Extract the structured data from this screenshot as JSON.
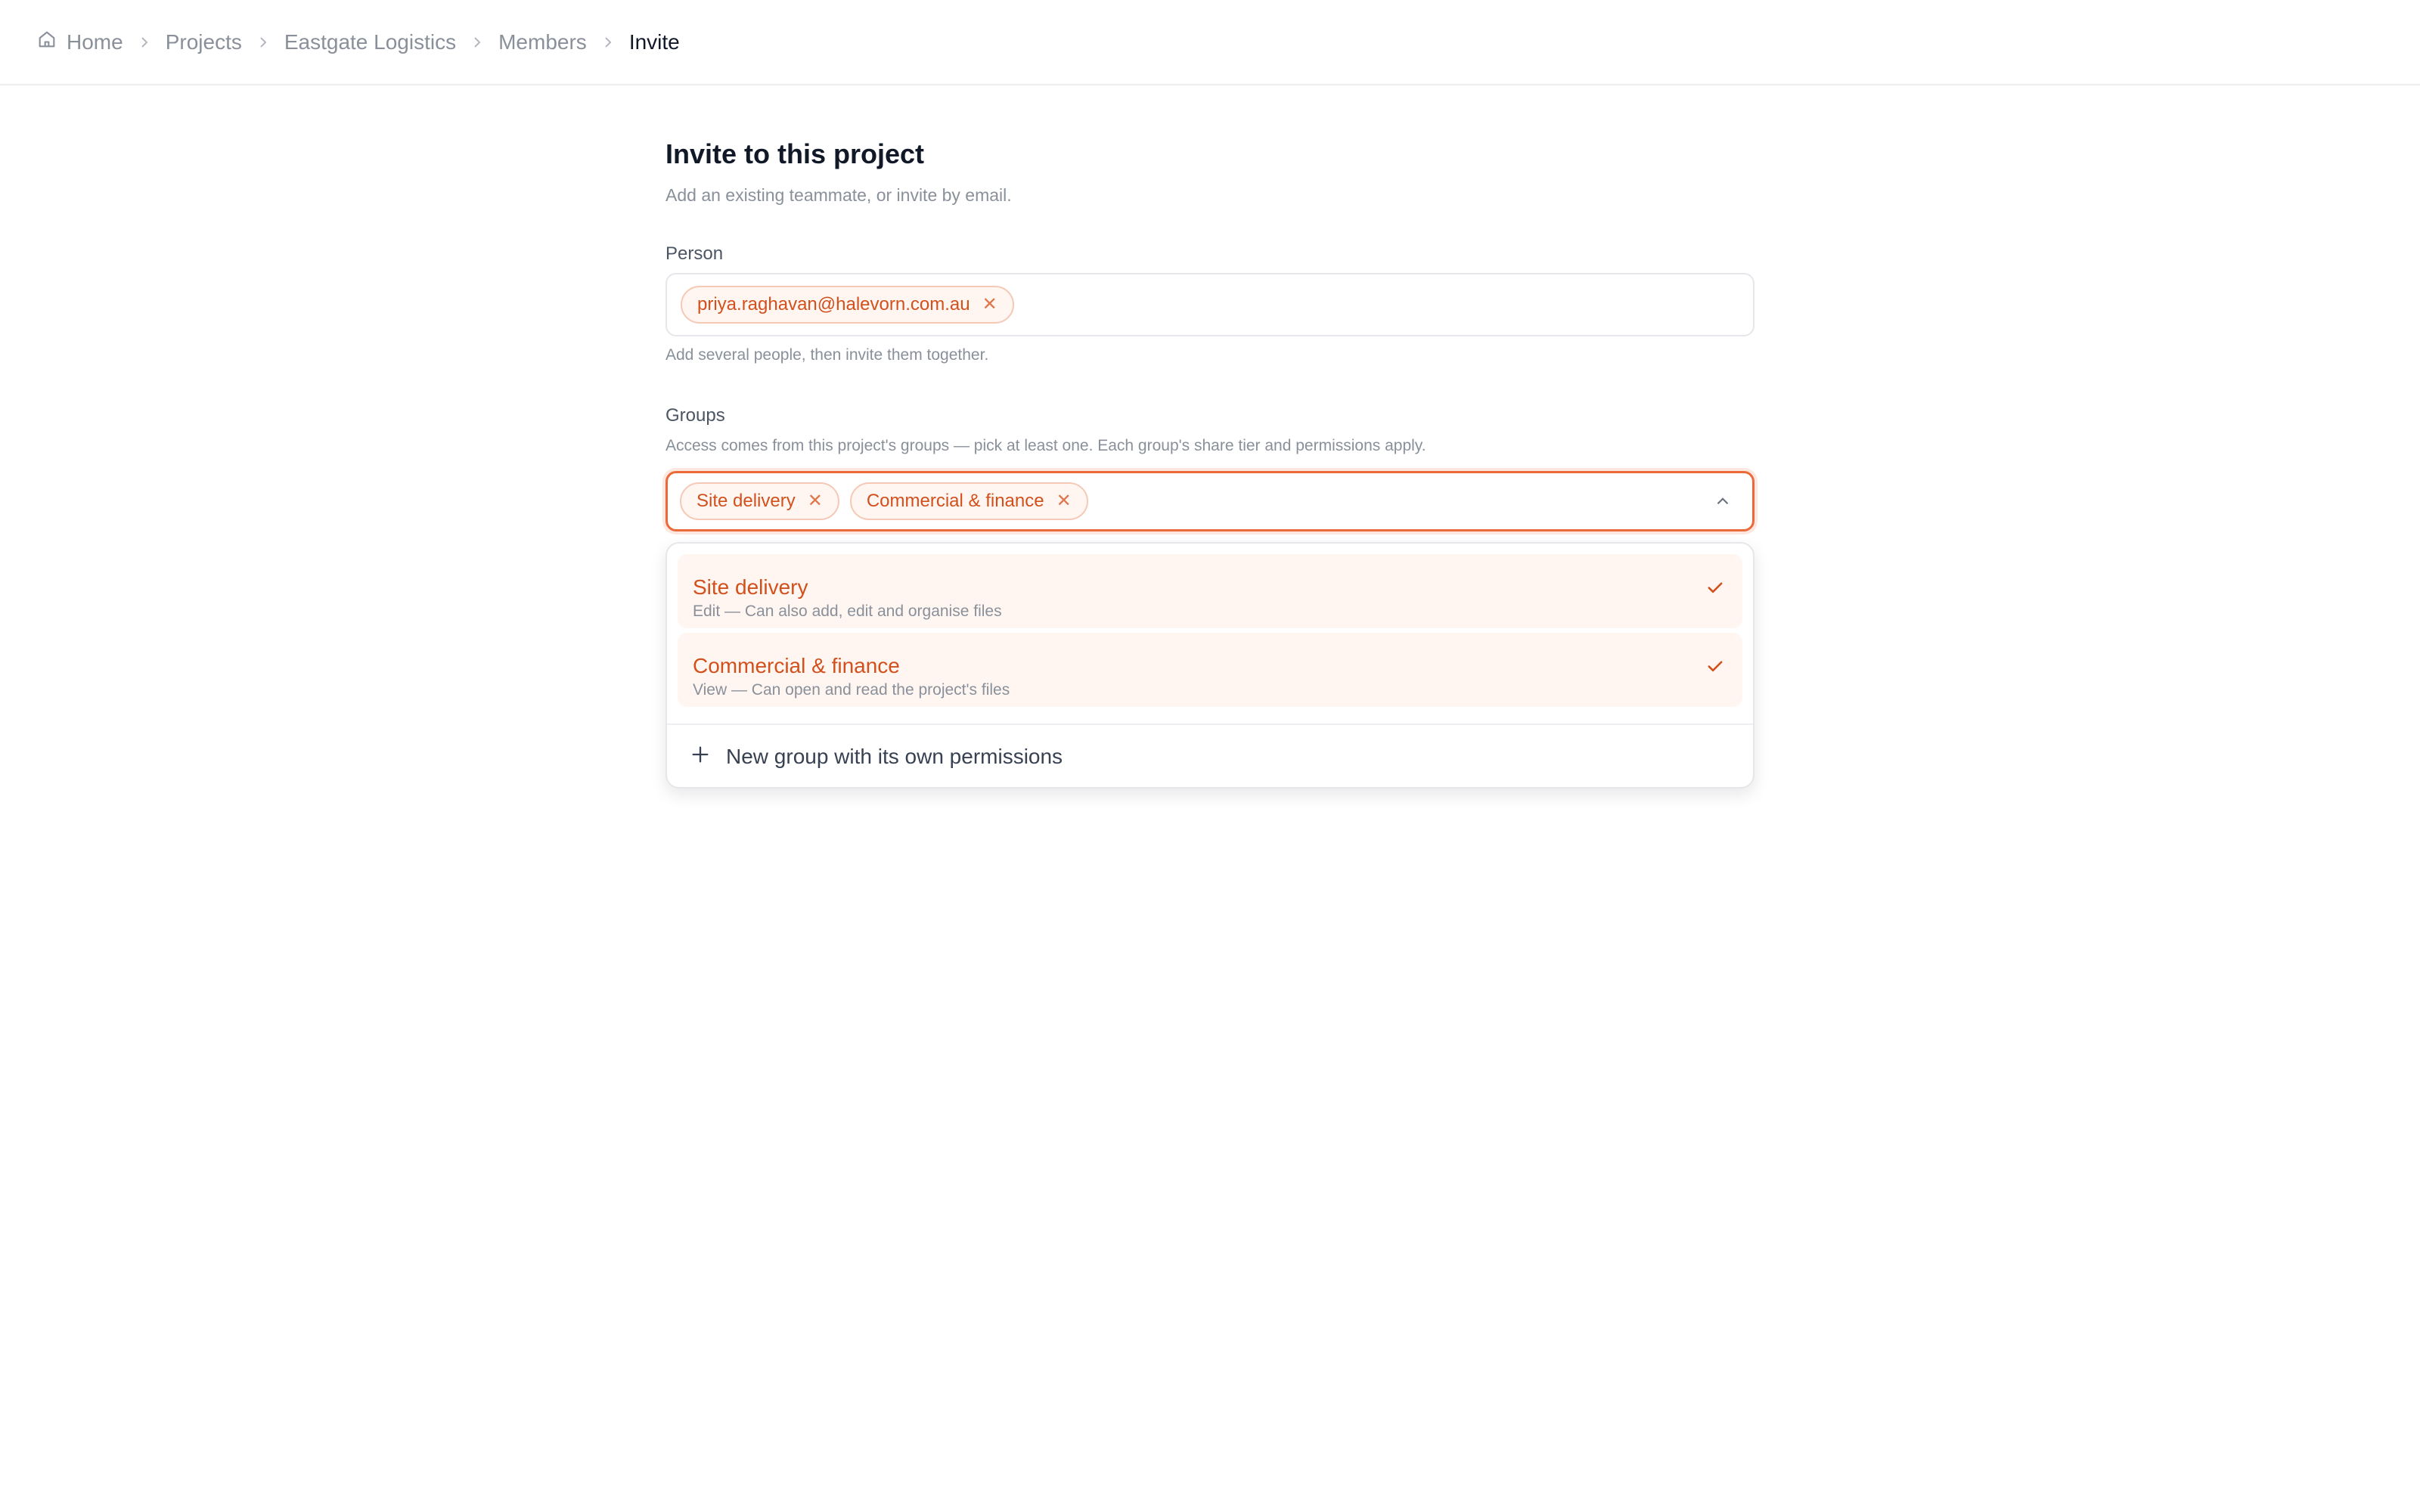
{
  "breadcrumb": {
    "items": [
      "Home",
      "Projects",
      "Eastgate Logistics",
      "Members"
    ],
    "current": "Invite"
  },
  "page": {
    "title": "Invite to this project",
    "subtitle": "Add an existing teammate, or invite by email."
  },
  "person": {
    "label": "Person",
    "chips": [
      "priya.raghavan@halevorn.com.au"
    ],
    "help": "Add several people, then invite them together."
  },
  "groups": {
    "label": "Groups",
    "help": "Access comes from this project's groups — pick at least one. Each group's share tier and permissions apply.",
    "chips": [
      "Site delivery",
      "Commercial & finance"
    ],
    "options": [
      {
        "name": "Site delivery",
        "description": "Edit — Can also add, edit and organise files",
        "selected": true
      },
      {
        "name": "Commercial & finance",
        "description": "View — Can open and read the project's files",
        "selected": true
      }
    ],
    "new_group_label": "New group with its own permissions"
  },
  "icons": {
    "home": "home-icon",
    "separator": "chevron-right-icon",
    "remove": "close-icon",
    "dropdown_toggle": "chevron-up-icon",
    "selected": "check-icon",
    "add": "plus-icon"
  },
  "colors": {
    "accent": "#d2501c",
    "chip_bg": "#fff6f2",
    "chip_border": "#f5c9b6",
    "focus_border": "#ec6a3a",
    "muted_text": "#8a909a"
  }
}
